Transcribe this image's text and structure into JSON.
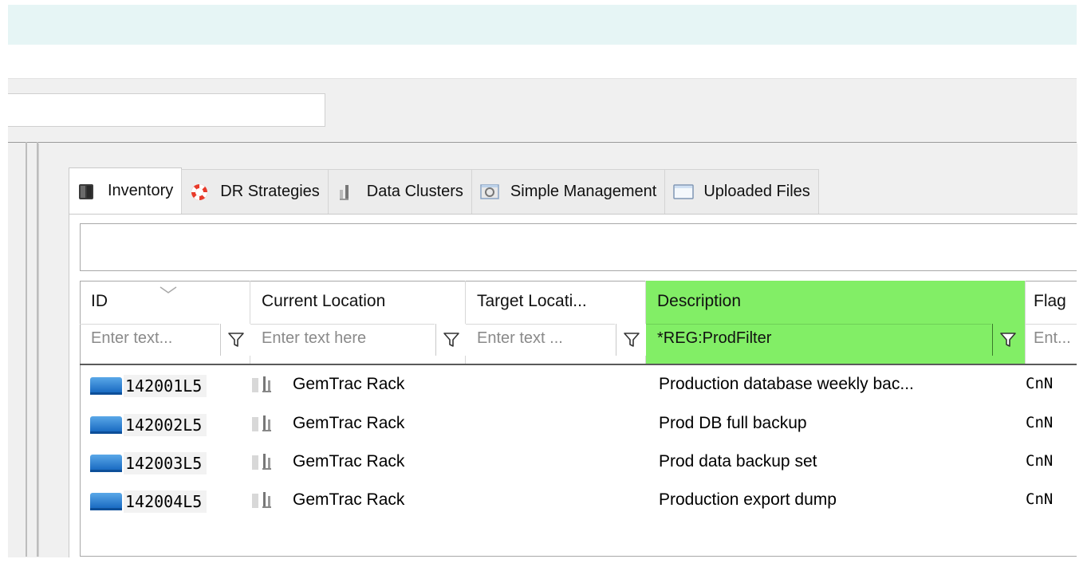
{
  "tabs": [
    {
      "label": "Inventory",
      "icon": "tape-drive-icon",
      "active": true
    },
    {
      "label": "DR Strategies",
      "icon": "lifebuoy-icon",
      "active": false
    },
    {
      "label": "Data Clusters",
      "icon": "cluster-icon",
      "active": false
    },
    {
      "label": "Simple Management",
      "icon": "monitor-icon",
      "active": false
    },
    {
      "label": "Uploaded Files",
      "icon": "screen-icon",
      "active": false
    }
  ],
  "columns": [
    {
      "title": "ID",
      "filter_placeholder": "Enter text..."
    },
    {
      "title": "Current Location",
      "filter_placeholder": "Enter text here"
    },
    {
      "title": "Target Locati...",
      "filter_placeholder": "Enter text ..."
    },
    {
      "title": "Description",
      "filter_value": "*REG:ProdFilter"
    },
    {
      "title": "Flag",
      "filter_placeholder": "Ent..."
    }
  ],
  "rows": [
    {
      "id": "142001L5",
      "current_location": "GemTrac Rack",
      "target_location": "",
      "description": "Production database weekly bac...",
      "flag": "CnN"
    },
    {
      "id": "142002L5",
      "current_location": "GemTrac Rack",
      "target_location": "",
      "description": "Prod DB full backup",
      "flag": "CnN"
    },
    {
      "id": "142003L5",
      "current_location": "GemTrac Rack",
      "target_location": "",
      "description": "Prod data backup set",
      "flag": "CnN"
    },
    {
      "id": "142004L5",
      "current_location": "GemTrac Rack",
      "target_location": "",
      "description": "Production export dump",
      "flag": "CnN"
    }
  ],
  "colors": {
    "highlight_column": "#82ee66",
    "header_band": "#e6f5f5",
    "panel_bg": "#f0f0f0"
  }
}
